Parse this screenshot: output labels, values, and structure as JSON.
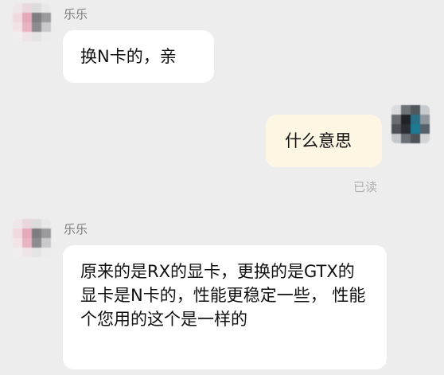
{
  "messages": [
    {
      "side": "left",
      "sender": "乐乐",
      "text": "换N卡的，亲"
    },
    {
      "side": "right",
      "text": "什么意思",
      "status": "已读"
    },
    {
      "side": "left",
      "sender": "乐乐",
      "text": "原来的是RX的显卡，更换的是GTX的显卡是N卡的，性能更稳定一些， 性能个您用的这个是一样的"
    }
  ]
}
